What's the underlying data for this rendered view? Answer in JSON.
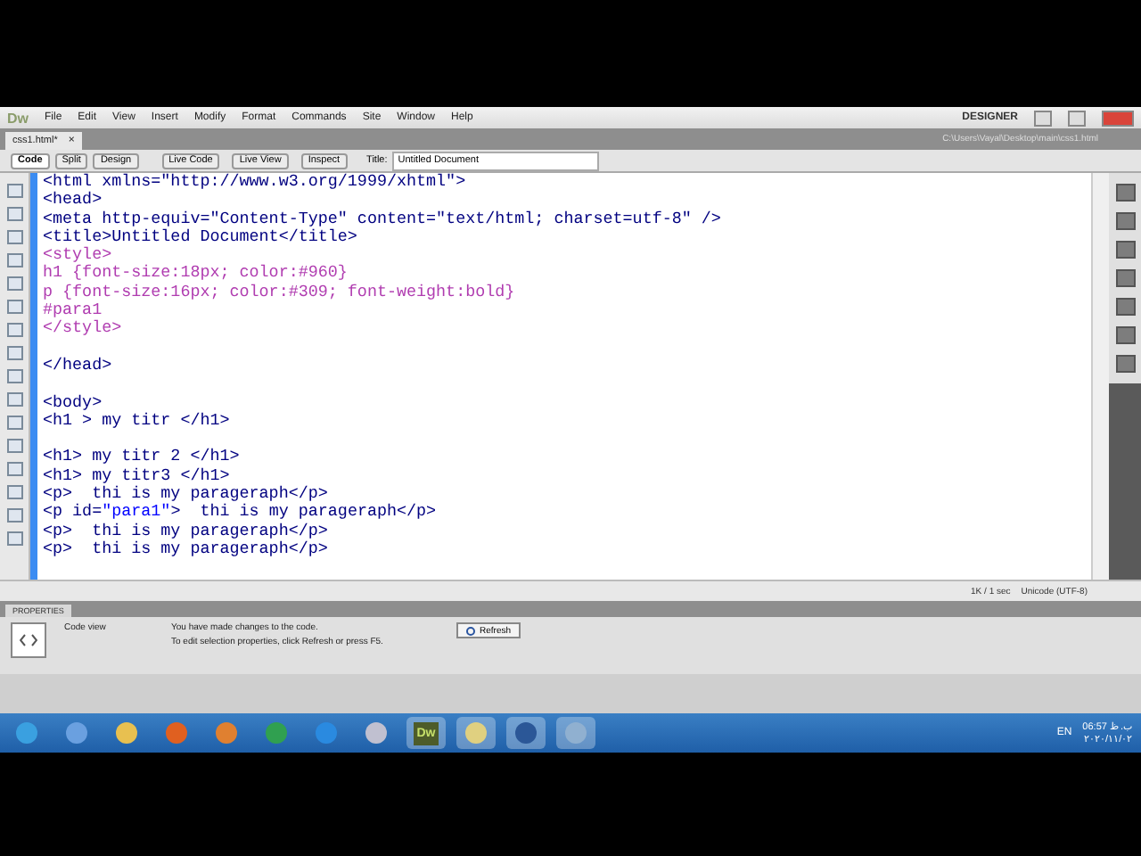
{
  "app": {
    "logo": "Dw",
    "menus": [
      "File",
      "Edit",
      "View",
      "Insert",
      "Modify",
      "Format",
      "Commands",
      "Site",
      "Window",
      "Help"
    ],
    "workspace": "DESIGNER"
  },
  "document_tab": {
    "label": "css1.html*",
    "close": "×",
    "path": "C:\\Users\\Vayal\\Desktop\\main\\css1.html"
  },
  "view_buttons": [
    {
      "label": "Code",
      "selected": true
    },
    {
      "label": "Split",
      "selected": false
    },
    {
      "label": "Design",
      "selected": false
    }
  ],
  "live_buttons": [
    {
      "label": "Live Code"
    },
    {
      "label": "Live View"
    },
    {
      "label": "Inspect"
    }
  ],
  "title_field": {
    "label": "Title:",
    "value": "Untitled Document"
  },
  "code_blocks": [
    [
      [
        {
          "kind": "tag",
          "text": "<html xmlns=\"http://www.w3.org/1999/xhtml\">"
        }
      ],
      [
        {
          "kind": "tag",
          "text": "<head>"
        }
      ],
      [
        {
          "kind": "tag",
          "text": "<meta http-equiv=\"Content-Type\" content=\"text/html; charset=utf-8\" />"
        }
      ],
      [
        {
          "kind": "tag",
          "text": "<title>Untitled Document</title>"
        }
      ],
      [
        {
          "kind": "css",
          "text": "<style>"
        }
      ],
      [
        {
          "kind": "css",
          "text": "h1 {font-size:18px; color:#960}"
        }
      ],
      [
        {
          "kind": "css",
          "text": "p {font-size:16px; color:#309; font-weight:bold}"
        }
      ],
      [
        {
          "kind": "css",
          "text": "#para1"
        }
      ],
      [
        {
          "kind": "css",
          "text": "</style>"
        }
      ]
    ],
    [
      [
        {
          "kind": "tag",
          "text": "</head>"
        }
      ]
    ],
    [
      [
        {
          "kind": "tag",
          "text": "<body>"
        }
      ],
      [
        {
          "kind": "tag",
          "text": "<h1 > my titr </h1>"
        }
      ]
    ],
    [
      [
        {
          "kind": "tag",
          "text": "<h1> my titr 2 </h1>"
        }
      ],
      [
        {
          "kind": "tag",
          "text": "<h1> my titr3 </h1>"
        }
      ],
      [
        {
          "kind": "tag",
          "text": "<p>  thi is my parageraph</p>"
        }
      ],
      [
        {
          "kind": "tag",
          "text": "<p id="
        },
        {
          "kind": "value",
          "text": "\"para1\""
        },
        {
          "kind": "tag",
          "text": ">  thi is my parageraph</p>"
        }
      ],
      [
        {
          "kind": "tag",
          "text": "<p>  thi is my parageraph</p>"
        }
      ],
      [
        {
          "kind": "tag",
          "text": "<p>  thi is my parageraph</p>"
        }
      ]
    ]
  ],
  "status_bar": {
    "size": "1K / 1 sec",
    "encoding": "Unicode (UTF-8)"
  },
  "properties": {
    "header": "PROPERTIES",
    "mode": "Code view",
    "message": "You have made changes to the code.",
    "hint": "To edit selection properties, click Refresh or press F5.",
    "refresh": "Refresh"
  },
  "taskbar": {
    "dw_label": "Dw",
    "language": "EN",
    "time": "06:57 ب.ظ",
    "date": "۲۰۲۰/۱۱/۰۲"
  }
}
